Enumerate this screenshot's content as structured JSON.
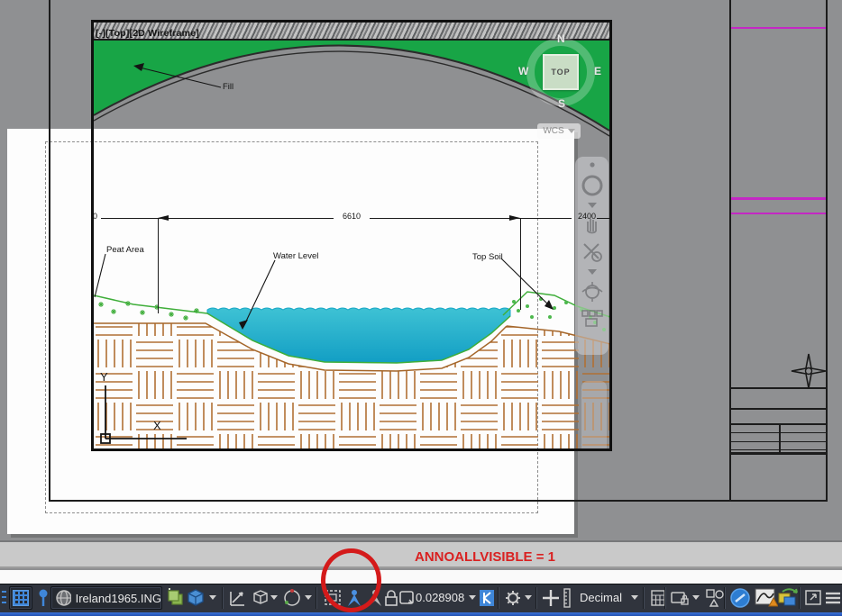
{
  "viewport": {
    "label": "[-][Top][2D Wireframe]",
    "viewcube": {
      "north": "N",
      "south": "S",
      "west": "W",
      "east": "E",
      "top": "TOP"
    },
    "wcs_label": "WCS"
  },
  "drawing": {
    "dimensions": {
      "left_value": "0",
      "span_value": "6610",
      "right_value": "2400"
    },
    "labels": {
      "fill": "Fill",
      "peat_area": "Peat Area",
      "water_level": "Water Level",
      "top_soil": "Top Soil"
    },
    "ucs": {
      "x_label": "X",
      "y_label": "Y"
    }
  },
  "annotation_overlay": {
    "text": "ANNOALLVISIBLE = 1"
  },
  "statusbar": {
    "filename": "Ireland1965.ING",
    "annotation_scale": "0.028908",
    "units": "Decimal"
  },
  "colors": {
    "fill_green": "#18a546",
    "water_teal": "#2bb3cc",
    "hatch_brown": "#b06f33",
    "frame_magenta": "#c428c4",
    "annotation_red": "#d92121",
    "accent_blue": "#3f86d8"
  }
}
